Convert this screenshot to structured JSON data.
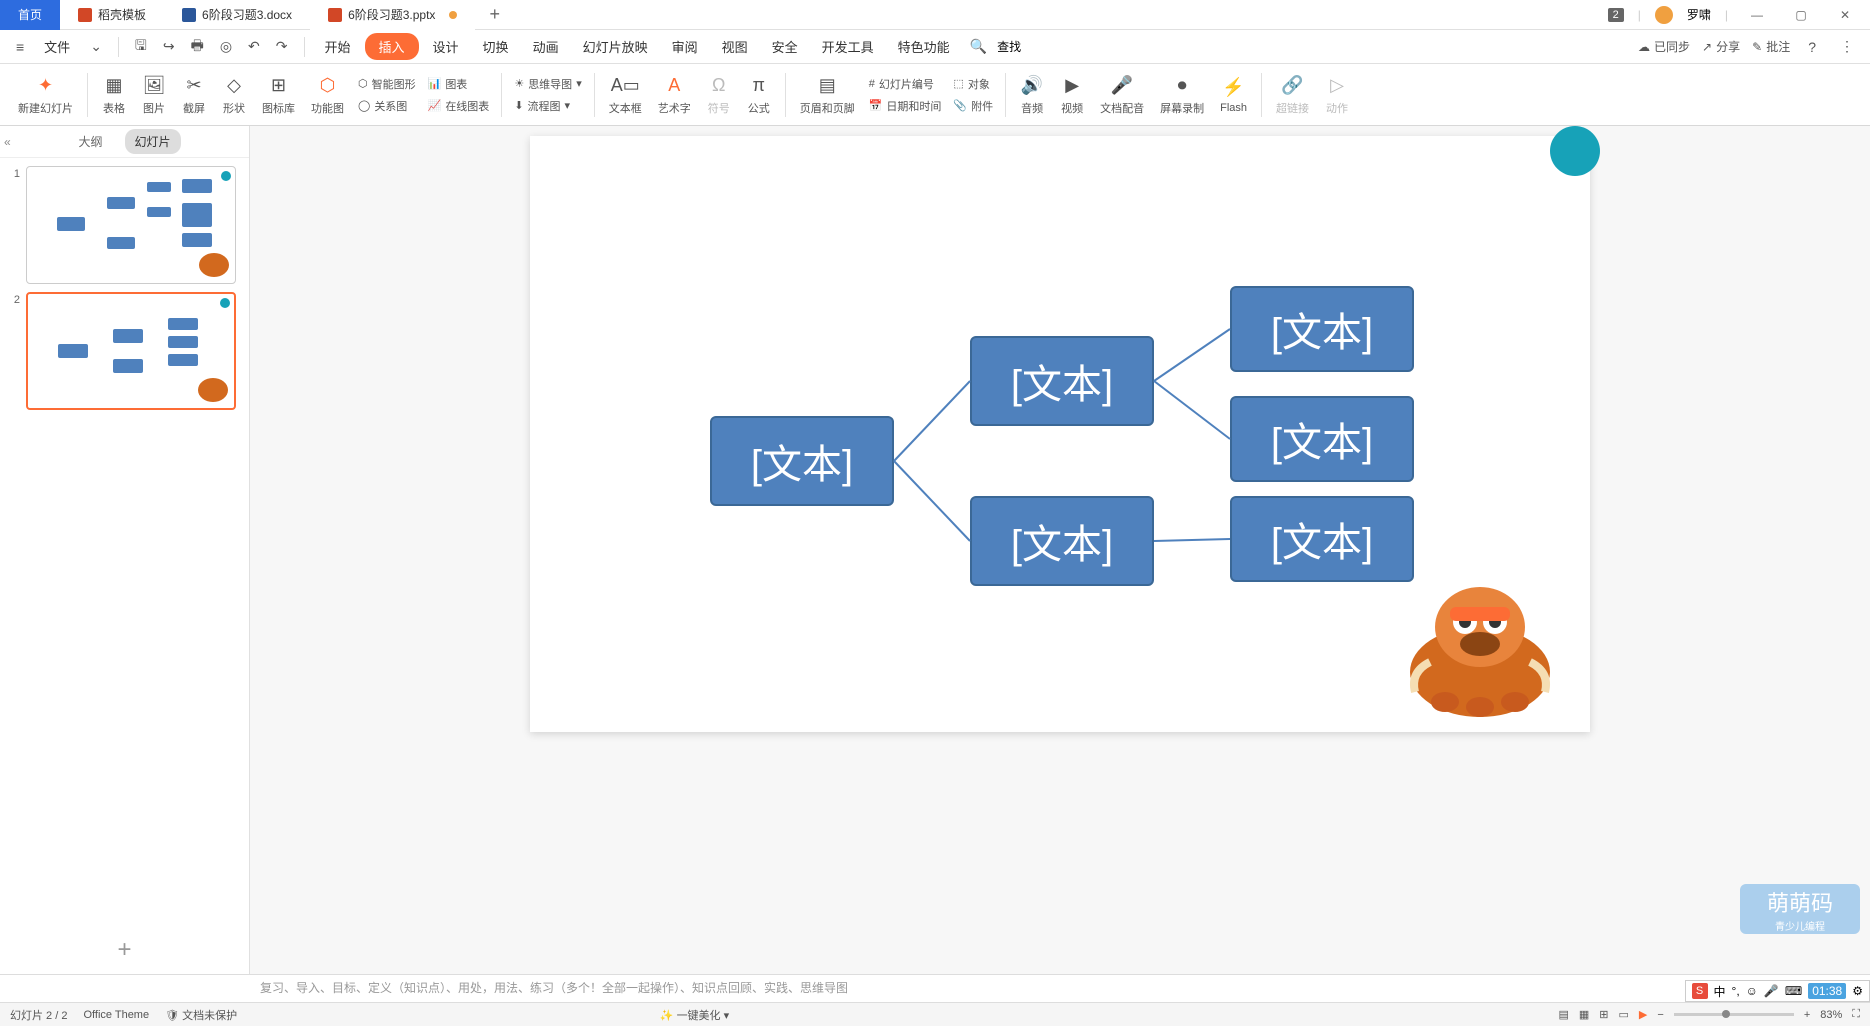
{
  "titlebar": {
    "home": "首页",
    "tabs": [
      {
        "icon": "red",
        "label": "稻壳模板"
      },
      {
        "icon": "blue",
        "label": "6阶段习题3.docx"
      },
      {
        "icon": "orange",
        "label": "6阶段习题3.pptx",
        "modified": true
      }
    ],
    "badge": "2",
    "user": "罗啸"
  },
  "menubar": {
    "file": "文件",
    "items": [
      "开始",
      "插入",
      "设计",
      "切换",
      "动画",
      "幻灯片放映",
      "审阅",
      "视图",
      "安全",
      "开发工具",
      "特色功能"
    ],
    "active": "插入",
    "search": "查找",
    "right": {
      "sync": "已同步",
      "share": "分享",
      "comment": "批注"
    }
  },
  "ribbon": {
    "new_slide": "新建幻灯片",
    "table": "表格",
    "image": "图片",
    "screenshot": "截屏",
    "shape": "形状",
    "icons": "图标库",
    "smartart": "功能图",
    "smart_shape": "智能图形",
    "chart": "图表",
    "relation": "关系图",
    "mindmap": "思维导图",
    "online_chart": "在线图表",
    "flowchart": "流程图",
    "textbox": "文本框",
    "wordart": "艺术字",
    "symbol": "符号",
    "equation": "公式",
    "header_footer": "页眉和页脚",
    "slide_number": "幻灯片编号",
    "date_time": "日期和时间",
    "object": "对象",
    "attachment": "附件",
    "audio": "音频",
    "video": "视频",
    "doc_voice": "文档配音",
    "screen_record": "屏幕录制",
    "flash": "Flash",
    "hyperlink": "超链接",
    "action": "动作"
  },
  "sidebar": {
    "outline": "大纲",
    "slides": "幻灯片"
  },
  "diagram": {
    "text": "[文本]"
  },
  "mascot": {
    "label": "萌萌码",
    "sublabel": "青少儿编程"
  },
  "notes": "复习、导入、目标、定义（知识点）、用处，用法、练习（多个！全部一起操作）、知识点回顾、实践、思维导图",
  "statusbar": {
    "slide": "幻灯片 2 / 2",
    "theme": "Office Theme",
    "protect": "文档未保护",
    "beautify": "一键美化",
    "zoom": "83%"
  },
  "ime": {
    "mode": "中",
    "time": "01:38"
  }
}
